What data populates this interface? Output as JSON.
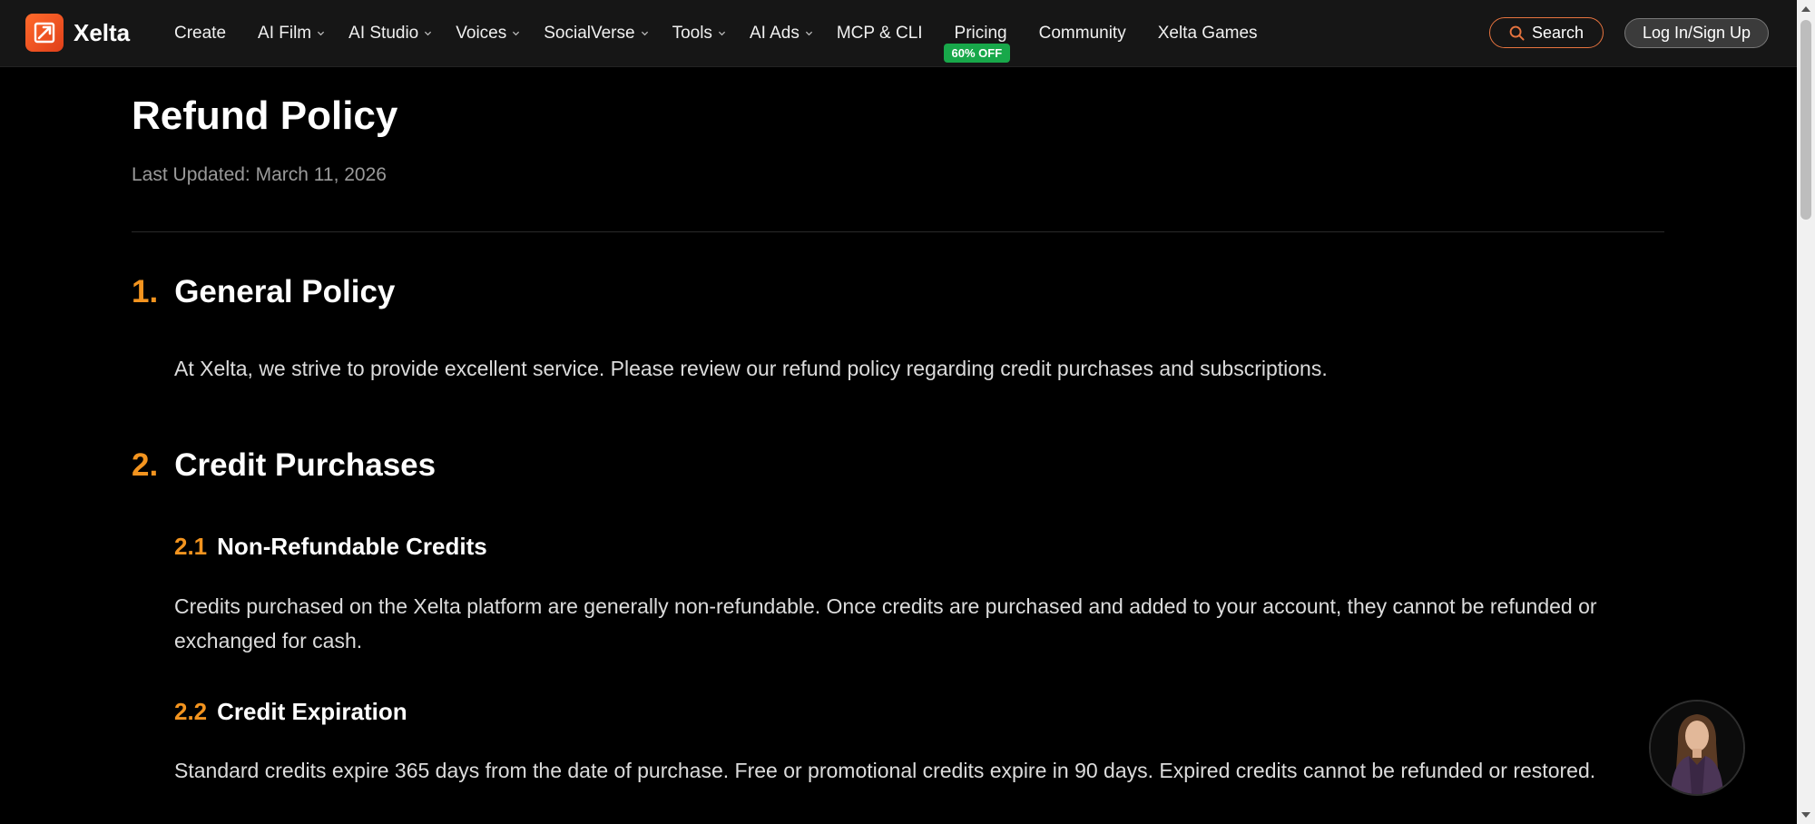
{
  "brand": {
    "name": "Xelta"
  },
  "nav": {
    "items": [
      {
        "label": "Create"
      },
      {
        "label": "AI Film"
      },
      {
        "label": "AI Studio"
      },
      {
        "label": "Voices"
      },
      {
        "label": "SocialVerse"
      },
      {
        "label": "Tools"
      },
      {
        "label": "AI Ads"
      },
      {
        "label": "MCP & CLI"
      },
      {
        "label": "Pricing",
        "badge": "60% OFF"
      },
      {
        "label": "Community"
      },
      {
        "label": "Xelta Games"
      }
    ],
    "search_label": "Search",
    "login_label": "Log In/Sign Up"
  },
  "page": {
    "title": "Refund Policy",
    "last_updated": "Last Updated: March 11, 2026",
    "sections": [
      {
        "number": "1.",
        "title": "General Policy",
        "body": "At Xelta, we strive to provide excellent service. Please review our refund policy regarding credit purchases and subscriptions."
      },
      {
        "number": "2.",
        "title": "Credit Purchases",
        "subsections": [
          {
            "number": "2.1",
            "title": "Non-Refundable Credits",
            "body": "Credits purchased on the Xelta platform are generally non-refundable. Once credits are purchased and added to your account, they cannot be refunded or exchanged for cash."
          },
          {
            "number": "2.2",
            "title": "Credit Expiration",
            "body": "Standard credits expire 365 days from the date of purchase. Free or promotional credits expire in 90 days. Expired credits cannot be refunded or restored."
          }
        ]
      }
    ]
  },
  "colors": {
    "accent": "#f3941f",
    "badge": "#18a84a",
    "search_border": "#e8743f",
    "background": "#000000",
    "topbar": "#161616"
  },
  "icons": {
    "logo": "xelta-logo-icon",
    "search": "search-icon",
    "chevron": "chevron-down-icon",
    "assistant": "assistant-avatar"
  }
}
